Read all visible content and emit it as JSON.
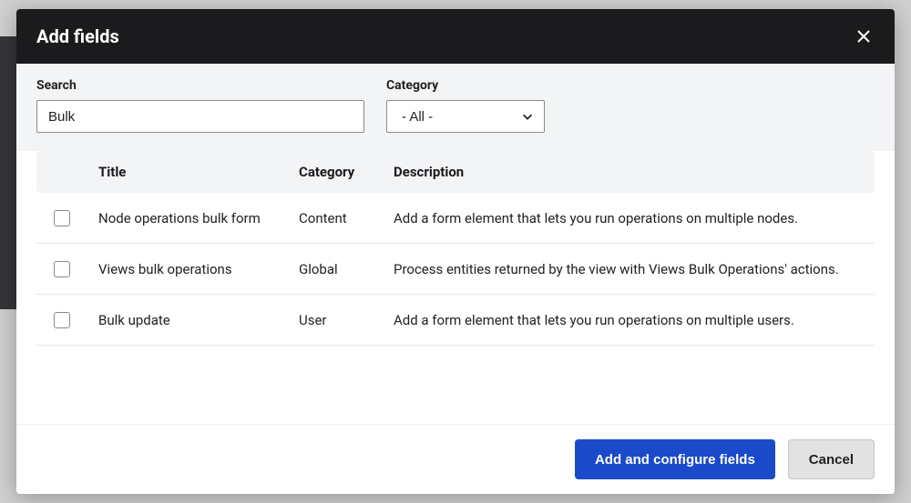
{
  "modal": {
    "title": "Add fields",
    "search_label": "Search",
    "search_value": "Bulk",
    "category_label": "Category",
    "category_selected": "- All -"
  },
  "table": {
    "headers": {
      "title": "Title",
      "category": "Category",
      "description": "Description"
    },
    "rows": [
      {
        "title": "Node operations bulk form",
        "category": "Content",
        "description": "Add a form element that lets you run operations on multiple nodes."
      },
      {
        "title": "Views bulk operations",
        "category": "Global",
        "description": "Process entities returned by the view with Views Bulk Operations' actions."
      },
      {
        "title": "Bulk update",
        "category": "User",
        "description": "Add a form element that lets you run operations on multiple users."
      }
    ]
  },
  "footer": {
    "primary": "Add and configure fields",
    "cancel": "Cancel"
  }
}
